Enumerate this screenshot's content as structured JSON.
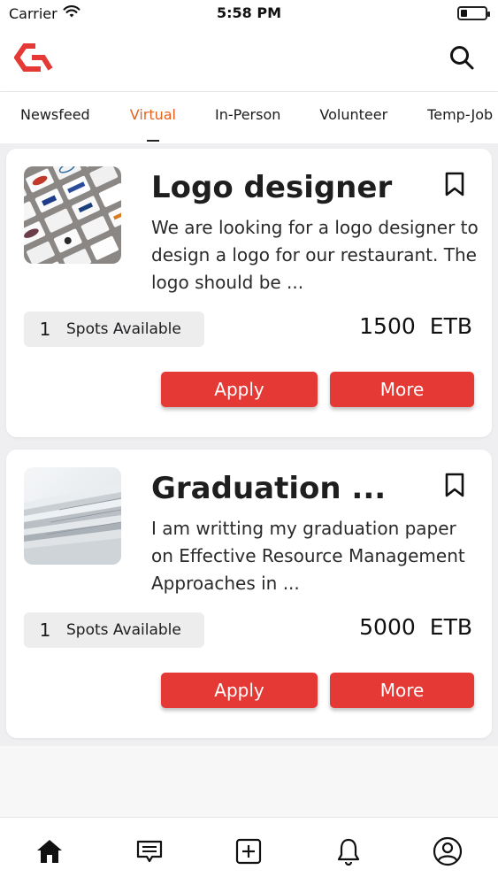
{
  "status_bar": {
    "carrier": "Carrier",
    "time": "5:58 PM",
    "battery_level": 0.25
  },
  "brand": {
    "accent": "#e5621f",
    "button_color": "#e53935"
  },
  "header": {
    "logo_icon": "app-logo-icon",
    "search_icon": "search-icon"
  },
  "tabs": [
    {
      "label": "Newsfeed",
      "active": false
    },
    {
      "label": "Virtual",
      "active": true
    },
    {
      "label": "In-Person",
      "active": false
    },
    {
      "label": "Volunteer",
      "active": false
    },
    {
      "label": "Temp-Job",
      "active": false
    }
  ],
  "jobs": [
    {
      "title": "Logo designer",
      "description": "We are looking for a logo designer to design a logo for our restaurant. The logo should be ...",
      "spots_count": "1",
      "spots_label": "Spots Available",
      "price": "1500",
      "currency": "ETB",
      "apply_label": "Apply",
      "more_label": "More",
      "thumbnail": "logo-cards-image"
    },
    {
      "title": "Graduation ...",
      "description": "I am writting my graduation paper on Effective Resource Management Approaches in ...",
      "spots_count": "1",
      "spots_label": "Spots Available",
      "price": "5000",
      "currency": "ETB",
      "apply_label": "Apply",
      "more_label": "More",
      "thumbnail": "paper-stack-image"
    }
  ],
  "bottom_nav": [
    {
      "icon": "home-icon",
      "active": true
    },
    {
      "icon": "messages-icon",
      "active": false
    },
    {
      "icon": "add-post-icon",
      "active": false
    },
    {
      "icon": "notifications-icon",
      "active": false
    },
    {
      "icon": "profile-icon",
      "active": false
    }
  ]
}
